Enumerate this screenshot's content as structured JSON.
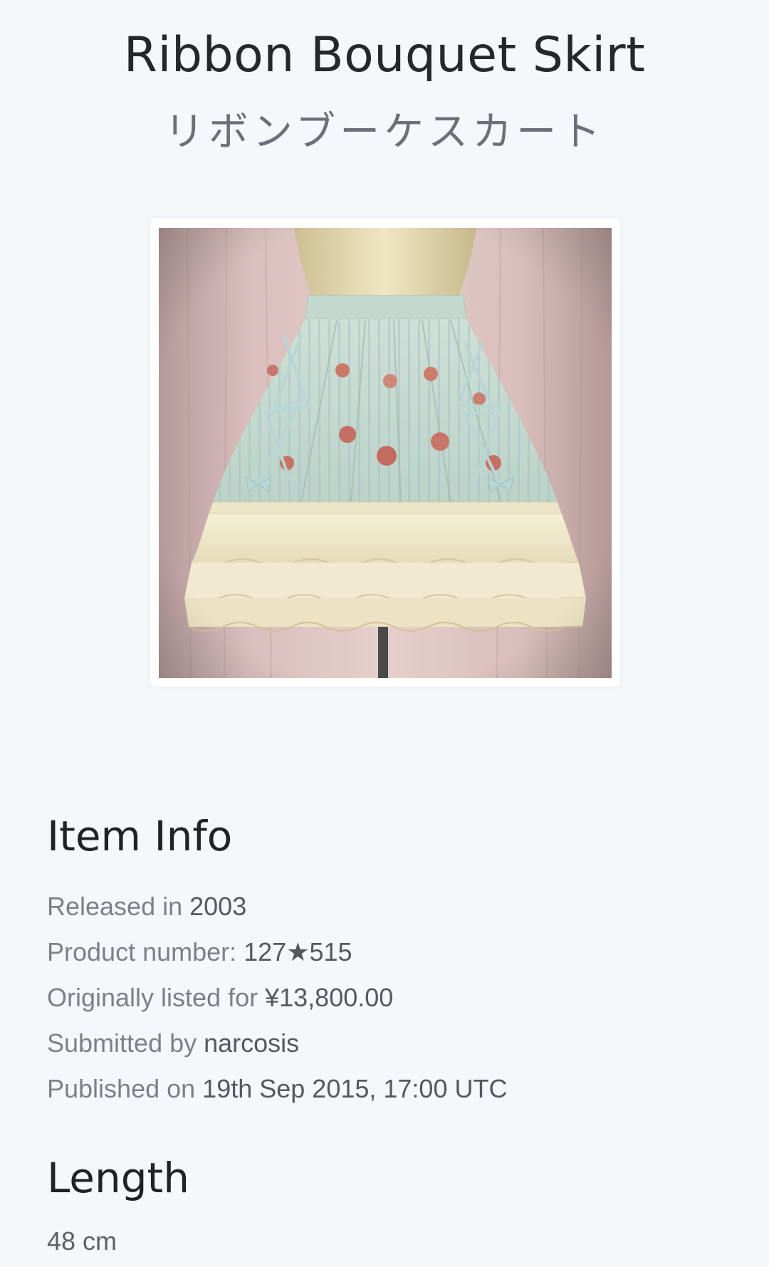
{
  "header": {
    "title": "Ribbon Bouquet Skirt",
    "subtitle": "リボンブーケスカート"
  },
  "image": {
    "description": "skirt-product-photo"
  },
  "item_info": {
    "heading": "Item Info",
    "rows": [
      {
        "label": "Released in ",
        "value": "2003"
      },
      {
        "label": "Product number: ",
        "value": "127★515"
      },
      {
        "label": "Originally listed for ",
        "value": "¥13,800.00"
      },
      {
        "label": "Submitted by ",
        "value": "narcosis"
      },
      {
        "label": "Published on ",
        "value": "19th Sep 2015, 17:00 UTC"
      }
    ]
  },
  "length": {
    "heading": "Length",
    "value": "48 cm"
  },
  "colors": {
    "background": "#f4f8fb",
    "title": "#25272b",
    "subtitle": "#6b7078",
    "label": "#7c8088",
    "value": "#55585f"
  }
}
